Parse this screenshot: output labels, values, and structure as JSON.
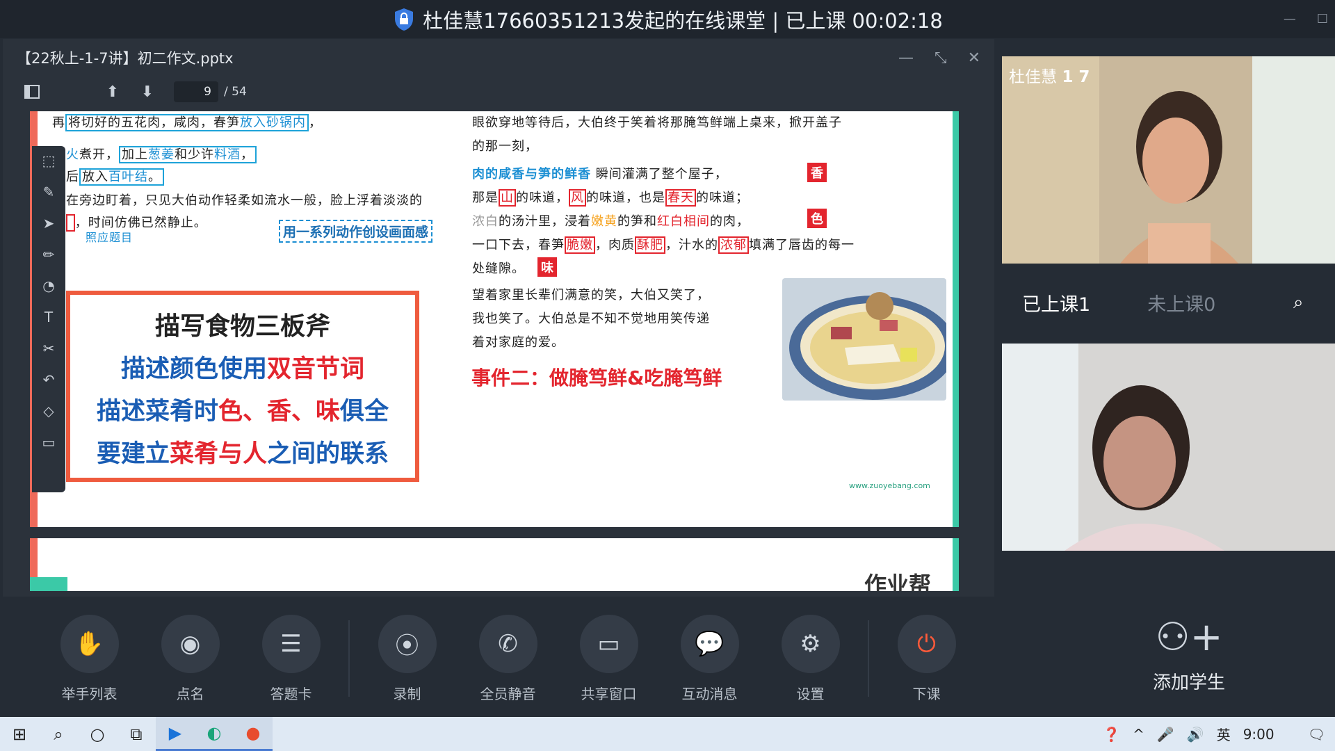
{
  "window": {
    "title": "杜佳慧17660351213发起的在线课堂 | 已上课 00:02:18"
  },
  "doc": {
    "title": "【22秋上-1-7讲】初二作文.pptx",
    "page": "9",
    "total": "/ 54"
  },
  "slide": {
    "lines_left": [
      {
        "parts": [
          {
            "t": "再",
            "c": ""
          },
          {
            "t": "将切好的五花肉，咸肉，春笋",
            "c": "hl"
          },
          {
            "t": "放入砂锅内",
            "c": "hl blue"
          },
          {
            "t": "，",
            "c": ""
          }
        ]
      },
      {
        "parts": [
          {
            "t": "火",
            "c": "blue"
          },
          {
            "t": "煮开，",
            "c": ""
          },
          {
            "t": "加上",
            "c": ""
          },
          {
            "t": "葱姜",
            "c": "blue"
          },
          {
            "t": "和少许",
            "c": ""
          },
          {
            "t": "料酒",
            "c": "blue"
          },
          {
            "t": "，",
            "c": ""
          }
        ]
      },
      {
        "parts": [
          {
            "t": "后",
            "c": ""
          },
          {
            "t": "放入",
            "c": ""
          },
          {
            "t": "百叶结",
            "c": "blue"
          },
          {
            "t": "。",
            "c": ""
          }
        ]
      },
      {
        "parts": [
          {
            "t": "在旁边盯着，只见大伯动作轻柔如流水一般，脸上浮着淡淡的",
            "c": ""
          }
        ]
      },
      {
        "parts": [
          {
            "t": "，时间仿佛已然静止。",
            "c": ""
          }
        ]
      }
    ],
    "note_small": "照应题目",
    "note_dashed": "用一系列动作创设画面感",
    "card_title": "描写食物三板斧",
    "card_lines": [
      {
        "a": "描述颜色使用",
        "b": "双音节词",
        "c": ""
      },
      {
        "a": "描述菜肴时",
        "b": "色、香、味",
        "c": "俱全"
      },
      {
        "a": "要建立",
        "b": "菜肴与人",
        "c": "之间的联系"
      }
    ],
    "right_line1": "眼欲穿地等待后，大伯终于笑着将那腌笃鲜端上桌来，掀开盖子",
    "right_line2": "的那一刻，",
    "right_line3a": "肉的咸香与笋的鲜香",
    "right_line3b": " 瞬间灌满了整个屋子，",
    "right_line4a": "那是",
    "right_line4b": "山",
    "right_line4c": "的味道，",
    "right_line4d": "风",
    "right_line4e": "的味道，也是",
    "right_line4f": "春天",
    "right_line4g": "的味道；",
    "right_line5a": "浓白",
    "right_line5b": "的汤汁里，浸着",
    "right_line5c": "嫩黄",
    "right_line5d": "的笋和",
    "right_line5e": "红白相间",
    "right_line5f": "的肉，",
    "right_line6a": "一口下去，春笋",
    "right_line6b": "脆嫩",
    "right_line6c": "，肉质",
    "right_line6d": "酥肥",
    "right_line6e": "，汁水的",
    "right_line6f": "浓郁",
    "right_line6g": "填满了唇齿的每一",
    "right_line7": "处缝隙。",
    "right_line8": "望着家里长辈们满意的笑，大伯又笑了，",
    "right_line9": "我也笑了。大伯总是不知不觉地用笑传递",
    "right_line10": "着对家庭的爱。",
    "tag_xiang": "香",
    "tag_se": "色",
    "tag_wei": "味",
    "event": "事件二：做腌笃鲜&吃腌笃鲜",
    "url": "www.zuoyebang.com",
    "next_brand": "作业帮"
  },
  "bottom": {
    "buttons": [
      "举手列表",
      "点名",
      "答题卡",
      "录制",
      "全员静音",
      "共享窗口",
      "互动消息",
      "设置",
      "下课"
    ]
  },
  "right": {
    "teacher_name": "杜佳慧",
    "teacher_num": "1 7",
    "tab_on": "已上课1",
    "tab_off": "未上课0",
    "add_label": "添加学生"
  },
  "taskbar": {
    "ime": "英",
    "time": "9:00"
  }
}
